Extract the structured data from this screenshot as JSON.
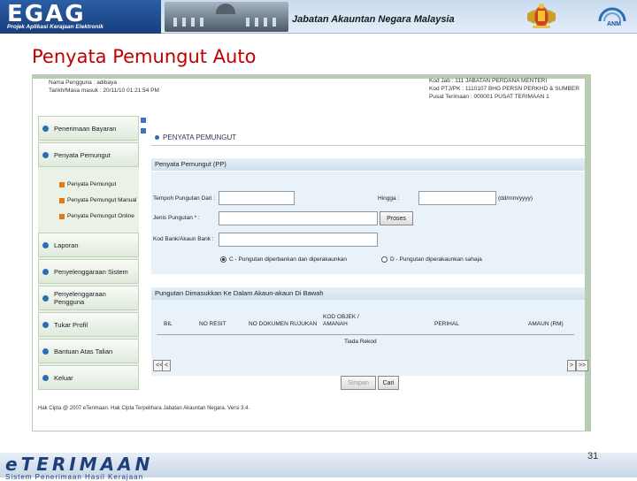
{
  "banner": {
    "logo": "EGAG",
    "logo_subtitle": "Projek Aplikasi Kerajaan Elektronik",
    "department": "Jabatan Akauntan Negara Malaysia",
    "anm_logo": "ANM"
  },
  "slide_title": "Penyata Pemungut Auto",
  "session": {
    "user_label": "Nama Pengguna : adibaya",
    "login_label": "Tarikh/Masa masuk : 20/11/10 01:21:54 PM",
    "ptj_label": "Kod Jab : 111 JABATAN PERDANA MENTERI",
    "ptj_code": "Kod PTJ/PK : 1110107 BHG PERSN PERKHD & SUMBER",
    "center_label": "Pusat Terimaan : 000001 PUSAT TERIMAAN 1"
  },
  "sidebar": {
    "items": [
      {
        "label": "Penerimaan Bayaran"
      },
      {
        "label": "Penyata Pemungut"
      },
      {
        "label": "Laporan"
      },
      {
        "label": "Penyelenggaraan Sistem"
      },
      {
        "label": "Penyelenggaraan Pengguna"
      },
      {
        "label": "Tukar Profil"
      },
      {
        "label": "Bantuan Atas Talian"
      },
      {
        "label": "Keluar"
      }
    ],
    "subitems": [
      {
        "label": "Penyata Pemungut"
      },
      {
        "label": "Penyata Pemungut Manual"
      },
      {
        "label": "Penyata Pemungut Online"
      }
    ]
  },
  "main": {
    "heading": "PENYATA PEMUNGUT",
    "section1": "Penyata Pemungut (PP)",
    "form": {
      "tempoh_label": "Tempoh Pungutan Dari :",
      "hingga_label": "Hingga :",
      "date_format": "(dd/mm/yyyy)",
      "jenis_label": "Jenis Pungutan * :",
      "proses_btn": "Proses",
      "kod_bank_label": "Kod Bank/Akaun Bank :",
      "radio_c": "C - Pungutan diperbankan dan diperakaunkan",
      "radio_d": "D - Pungutan diperakaunkan sahaja"
    },
    "section2": "Pungutan Dimasukkan Ke Dalam Akaun-akaun Di Bawah",
    "table": {
      "headers": [
        "BIL",
        "NO RESIT",
        "NO DOKUMEN RUJUKAN",
        "KOD OBJEK / AMANAH",
        "PERIHAL",
        "AMAUN (RM)"
      ],
      "empty_text": "Tiada Rekod"
    },
    "nav": {
      "first": "<<",
      "prev": "<",
      "next": ">",
      "last": ">>"
    },
    "buttons": {
      "save": "Simpan",
      "cari": "Cari"
    }
  },
  "footer": {
    "copyright": "Hak Cipta @ 2007 eTerimaan. Hak Cipta Terpelihara Jabatan Akauntan Negara. Versi 3.4."
  },
  "bottom": {
    "brand": "eTERIMAAN",
    "tagline": "Sistem Penerimaan Hasil Kerajaan",
    "page_number": "31"
  }
}
